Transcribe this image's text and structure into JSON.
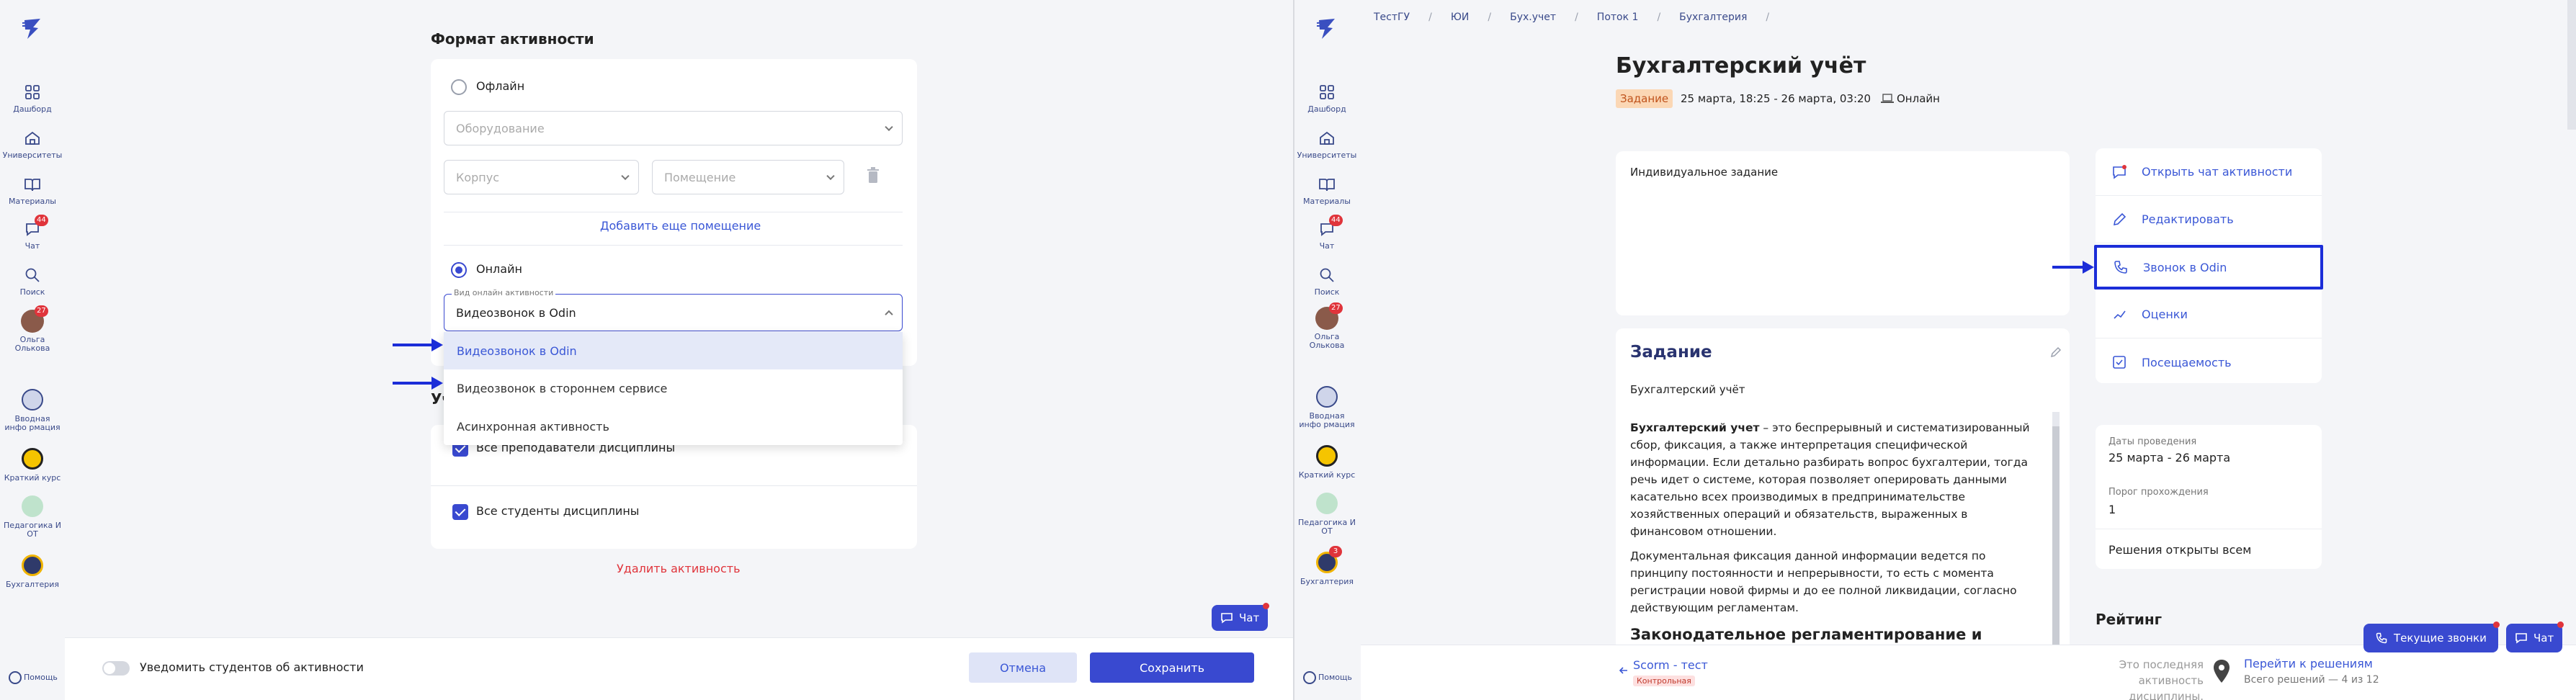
{
  "sidebar": {
    "items": [
      {
        "label": "Дашборд"
      },
      {
        "label": "Университеты"
      },
      {
        "label": "Материалы"
      },
      {
        "label": "Чат",
        "badge": "44"
      },
      {
        "label": "Поиск"
      },
      {
        "label": "Ольга Олькова",
        "badge": "27"
      },
      {
        "label": "Вводная инфо рмация"
      },
      {
        "label": "Краткий курс"
      },
      {
        "label": "Педагогика И ОТ"
      },
      {
        "label": "Бухгалтерия",
        "badge": "3"
      }
    ],
    "help_label": "Помощь"
  },
  "left_form": {
    "section_title": "Формат активности",
    "offline_label": "Офлайн",
    "equipment_placeholder": "Оборудование",
    "building_placeholder": "Корпус",
    "room_placeholder": "Помещение",
    "add_room_link": "Добавить еще помещение",
    "online_label": "Онлайн",
    "online_type_label": "Вид онлайн активности",
    "online_type_value": "Видеозвонок в Odin",
    "dropdown_options": [
      "Видеозвонок в Odin",
      "Видеозвонок в стороннем сервисе",
      "Асинхронная активность"
    ],
    "participants_heading_fragment": "Уч",
    "all_teachers": "Все преподаватели дисциплины",
    "all_students": "Все студенты дисциплины",
    "delete_link": "Удалить активность",
    "notify_label": "Уведомить студентов об активности",
    "cancel_button": "Отмена",
    "save_button": "Сохранить",
    "chat_button": "Чат"
  },
  "right_page": {
    "breadcrumbs": [
      "ТестГУ",
      "/",
      "ЮИ",
      "/",
      "Бух.учет",
      "/",
      "Поток 1",
      "/",
      "Бухгалтерия",
      "/"
    ],
    "title": "Бухгалтерский учёт",
    "tag": "Задание",
    "dates": "25 марта, 18:25 - 26 марта, 03:20",
    "format": "Онлайн",
    "individual_task": "Индивидуальное задание",
    "actions": [
      "Открыть чат активности",
      "Редактировать",
      "Звонок в Odin",
      "Оценки",
      "Посещаемость"
    ],
    "dates_label": "Даты проведения",
    "dates_value": "25 марта - 26 марта",
    "threshold_label": "Порог прохождения",
    "threshold_value": "1",
    "solutions_open": "Решения открыты всем",
    "rating_title": "Рейтинг",
    "task_heading": "Задание",
    "task_subtitle": "Бухгалтерский учёт",
    "para1_bold": "Бухгалтерский учет",
    "para1_rest": " – это беспрерывный и систематизированный сбор, фиксация, а также интерпретация специфической информации. Если детально разбирать вопрос бухгалтерии, тогда речь идет о системе, которая позволяет оперировать данными касательно всех производимых в предпринимательстве хозяйственных операций и обязательств, выраженных в финансовом отношении.",
    "para2": "Документальная фиксация данной информации ведется по принципу постоянности и непрерывности, то есть с момента регистрации новой фирмы и до ее полной ликвидации, согласно действующим регламентам.",
    "subheading": "Законодательное регламентирование и основные определения бухучета",
    "prev_title": "Scorm - тест",
    "prev_tag": "Контрольная",
    "last_activity": "Это последняя активность дисциплины.",
    "go_to_solutions": "Перейти к решениям",
    "solutions_count": "Всего решений — 4 из 12",
    "current_calls": "Текущие звонки",
    "chat_button": "Чат"
  },
  "colors": {
    "accent": "#3949d0",
    "arrow": "#1b2dd8",
    "danger": "#e0343b",
    "tag_bg": "#fbd7b5"
  }
}
